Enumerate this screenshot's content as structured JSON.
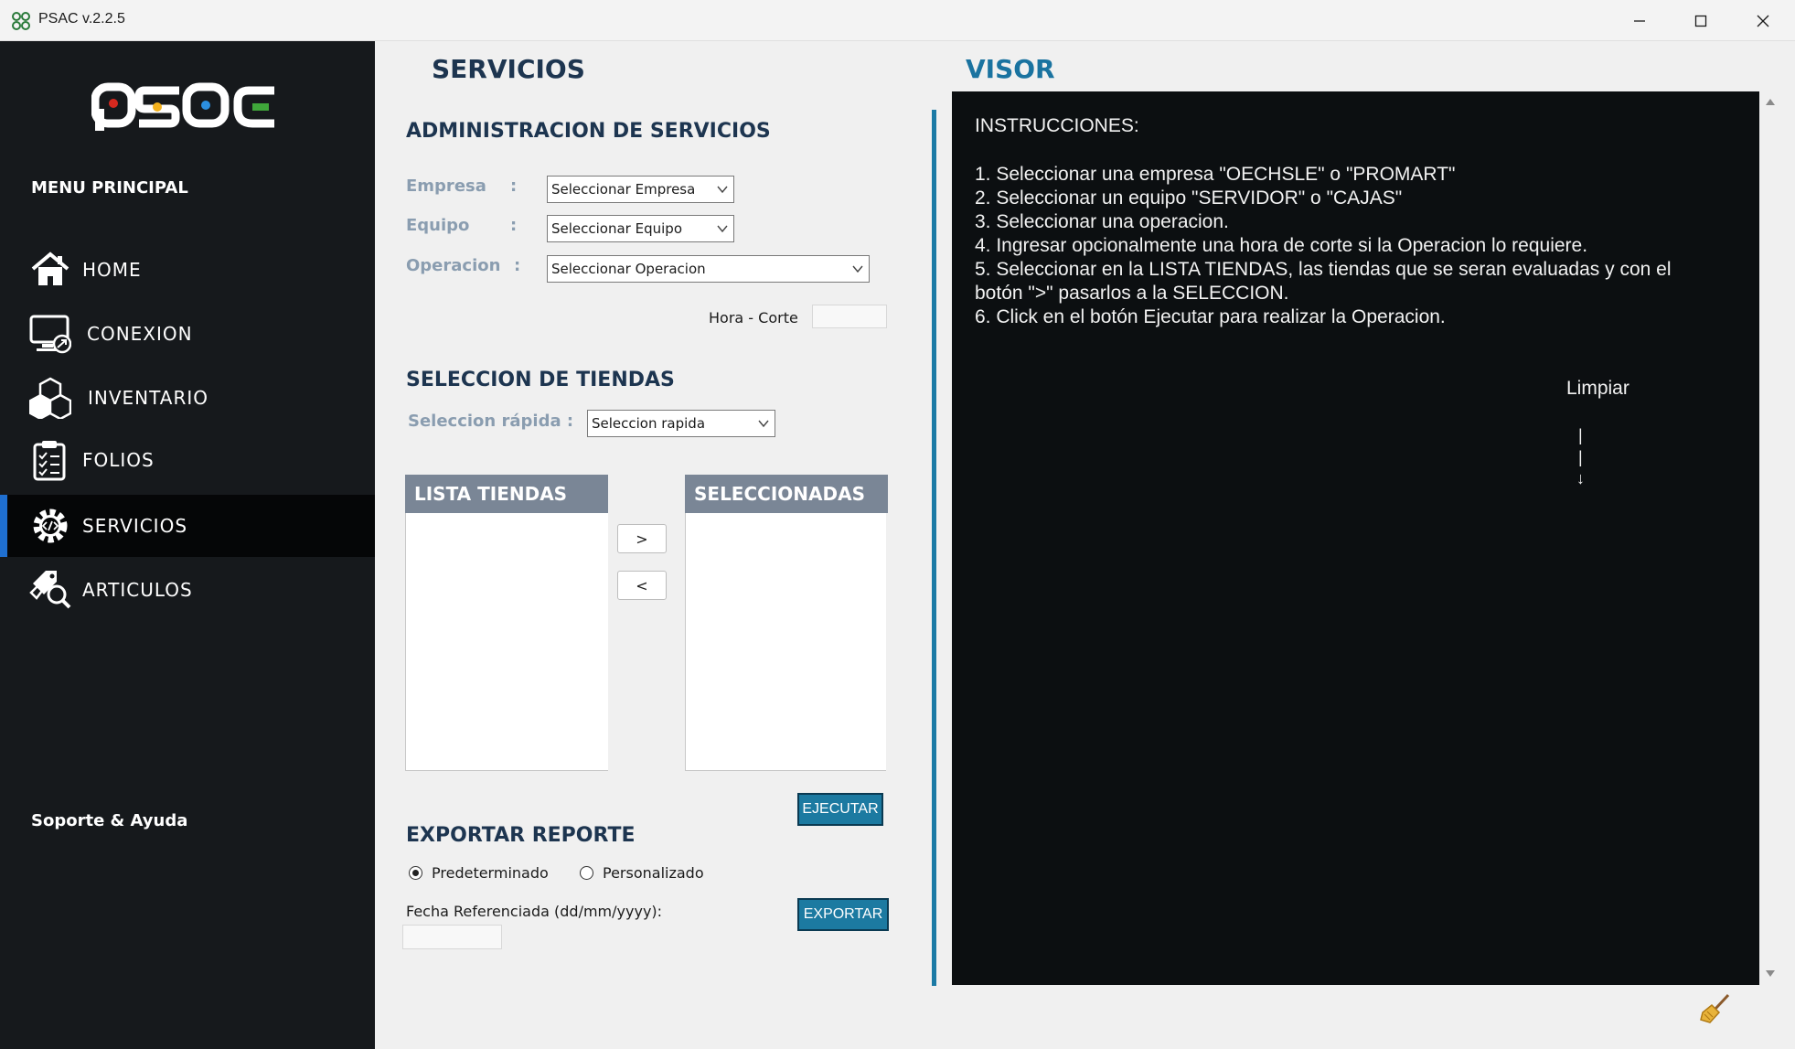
{
  "window": {
    "title": "PSAC v.2.2.5"
  },
  "sidebar": {
    "logo_text": "PSAC",
    "menu_title": "MENU PRINCIPAL",
    "items": [
      {
        "label": "HOME",
        "icon": "home-icon",
        "active": false
      },
      {
        "label": "CONEXION",
        "icon": "monitor-connection-icon",
        "active": false
      },
      {
        "label": "INVENTARIO",
        "icon": "boxes-icon",
        "active": false
      },
      {
        "label": "FOLIOS",
        "icon": "clipboard-icon",
        "active": false
      },
      {
        "label": "SERVICIOS",
        "icon": "gear-code-icon",
        "active": true
      },
      {
        "label": "ARTICULOS",
        "icon": "tags-search-icon",
        "active": false
      }
    ],
    "support": "Soporte & Ayuda"
  },
  "services": {
    "title": "SERVICIOS",
    "admin_title": "ADMINISTRACION DE SERVICIOS",
    "empresa_label": "Empresa",
    "equipo_label": "Equipo",
    "operacion_label": "Operacion",
    "colon": ":",
    "empresa_value": "Seleccionar Empresa",
    "equipo_value": "Seleccionar Equipo",
    "operacion_value": "Seleccionar Operacion",
    "hora_corte_label": "Hora - Corte",
    "hora_corte_value": "",
    "tiendas_title": "SELECCION DE TIENDAS",
    "seleccion_rapida_label": "Seleccion rápida :",
    "seleccion_rapida_value": "Seleccion rapida",
    "lista_tiendas_header": "LISTA TIENDAS",
    "seleccionadas_header": "SELECCIONADAS",
    "move_right": ">",
    "move_left": "<",
    "ejecutar": "EJECUTAR",
    "export_title": "EXPORTAR REPORTE",
    "radio_default": "Predeterminado",
    "radio_custom": "Personalizado",
    "radio_selected": "Predeterminado",
    "fecha_label": "Fecha Referenciada (dd/mm/yyyy):",
    "fecha_value": "",
    "exportar": "EXPORTAR"
  },
  "visor": {
    "title": "VISOR",
    "lines": [
      "INSTRUCCIONES:",
      "1. Seleccionar una empresa \"OECHSLE\" o \"PROMART\"",
      "2. Seleccionar un equipo \"SERVIDOR\" o \"CAJAS\"",
      "3. Seleccionar una operacion.",
      "4. Ingresar opcionalmente una hora de corte si la Operacion lo requiere.",
      "5. Seleccionar en la LISTA TIENDAS, las tiendas que se seran evaluadas y con el",
      "botón \">\" pasarlos a la SELECCION.",
      "6. Click en el botón Ejecutar para realizar la Operacion."
    ],
    "limpiar": "Limpiar",
    "arrow_lines": [
      "|",
      "|",
      "↓"
    ]
  },
  "colors": {
    "sidebar_bg": "#16191c",
    "accent": "#1c7aa1",
    "active_indicator": "#1f6fd0",
    "visor_bg": "#0c0f11",
    "heading": "#1d3550"
  }
}
